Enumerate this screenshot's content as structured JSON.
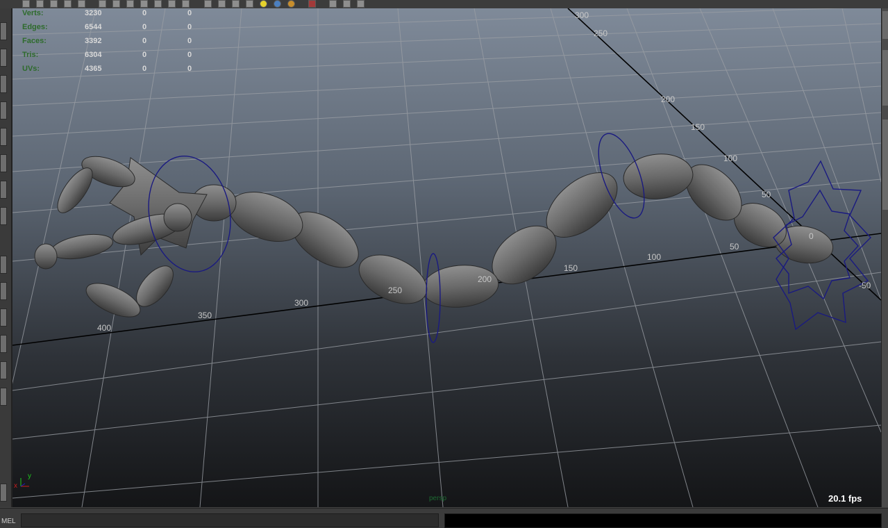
{
  "toolbar": {
    "icons": [
      "render-icon",
      "snap-icon",
      "grid-icon",
      "selection-mask-icon",
      "camera-icon",
      "wireframe-icon",
      "shaded-icon",
      "texture-icon",
      "light-icon",
      "isolate-icon",
      "xray-icon",
      "textured-sphere-icon",
      "lit-sphere-icon",
      "shadow-sphere-icon",
      "select-tool-icon",
      "cube-icon",
      "panel-icon",
      "graph-icon"
    ]
  },
  "hud": {
    "rows": [
      {
        "label": "Verts:",
        "v1": "3230",
        "v2": "0",
        "v3": "0"
      },
      {
        "label": "Edges:",
        "v1": "6544",
        "v2": "0",
        "v3": "0"
      },
      {
        "label": "Faces:",
        "v1": "3392",
        "v2": "0",
        "v3": "0"
      },
      {
        "label": "Tris:",
        "v1": "6304",
        "v2": "0",
        "v3": "0"
      },
      {
        "label": "UVs:",
        "v1": "4365",
        "v2": "0",
        "v3": "0"
      }
    ]
  },
  "grid_labels": {
    "horizontal": [
      "400",
      "350",
      "300",
      "250",
      "200",
      "150",
      "100",
      "50",
      "0",
      "-50"
    ],
    "depth": [
      "300",
      "250",
      "200",
      "150",
      "100",
      "50"
    ]
  },
  "viewport": {
    "camera": "persp",
    "fps": "20.1 fps",
    "axis_x": "x",
    "axis_y": "y",
    "colors": {
      "bg_top": "#7f8a99",
      "bg_bottom": "#141517",
      "grid": "#9a9ea4",
      "axis": "#000000",
      "mesh": "#6a6a6a",
      "curve": "#1a1a80"
    }
  },
  "statusbar": {
    "mel_label": "MEL"
  }
}
